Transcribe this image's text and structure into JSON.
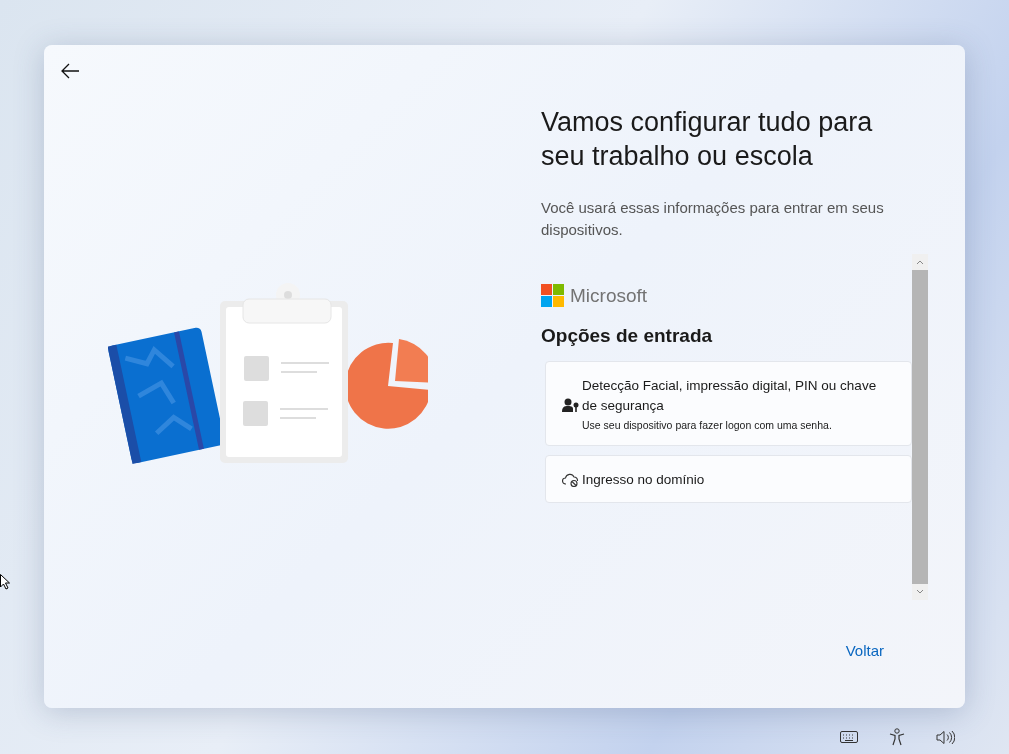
{
  "title": "Vamos configurar tudo para seu trabalho ou escola",
  "description": "Você usará essas informações para entrar em seus dispositivos.",
  "brand": "Microsoft",
  "section_title": "Opções de entrada",
  "options": [
    {
      "kind": "passkey",
      "label": "Detecção Facial, impressão digital, PIN ou chave de segurança",
      "subtitle": "Use seu dispositivo para fazer logon com uma senha."
    },
    {
      "kind": "domain",
      "label": "Ingresso no domínio"
    }
  ],
  "back_link": "Voltar"
}
